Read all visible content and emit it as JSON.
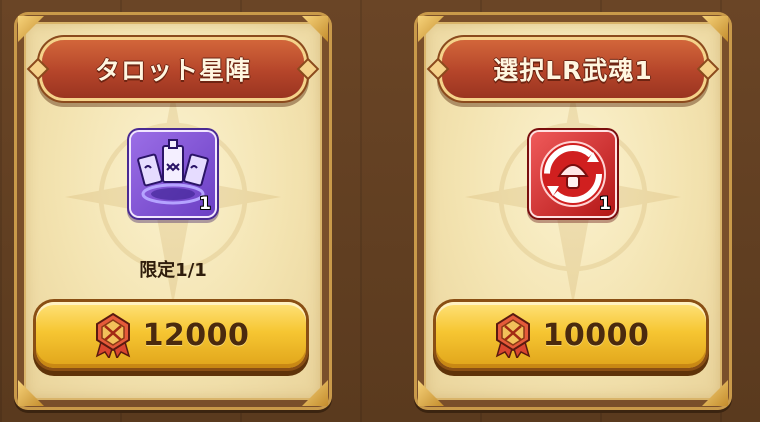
{
  "shop_items": [
    {
      "title": "タロット星陣",
      "item_icon": "tarot-star-formation-icon",
      "quantity": "1",
      "limit_label": "限定1/1",
      "price": "12000",
      "currency_icon": "red-crest-badge-icon"
    },
    {
      "title": "選択LR武魂1",
      "item_icon": "red-cycle-mushroom-icon",
      "quantity": "1",
      "limit_label": null,
      "price": "10000",
      "currency_icon": "red-crest-badge-icon"
    }
  ],
  "colors": {
    "banner": "#b5452a",
    "button": "#f6c632",
    "card_bg": "#f3e3b0",
    "tarot_icon": "#6b3fc4",
    "soul_icon": "#c81a1a"
  }
}
